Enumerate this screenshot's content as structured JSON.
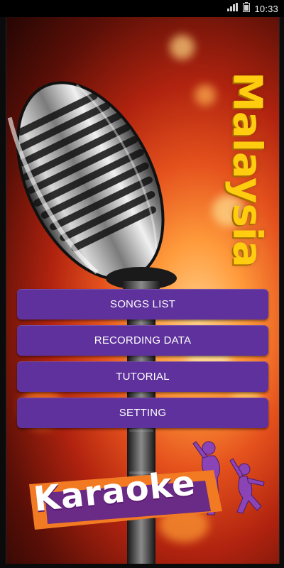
{
  "status_bar": {
    "time": "10:33",
    "icons": [
      "signal-icon",
      "battery-icon"
    ]
  },
  "app": {
    "title": "Malaysia",
    "logo_text": "Karaoke",
    "menu": [
      {
        "label": "SONGS LIST"
      },
      {
        "label": "RECORDING DATA"
      },
      {
        "label": "TUTORIAL"
      },
      {
        "label": "SETTING"
      }
    ]
  },
  "colors": {
    "button_bg": "#5e319c",
    "title": "#ffcc10",
    "status_bar_bg": "#000000",
    "logo_banner": "#f27a22",
    "logo_panel": "#6a2b86"
  }
}
